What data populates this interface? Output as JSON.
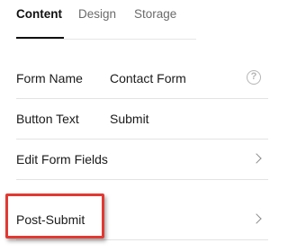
{
  "tabs": [
    {
      "label": "Content",
      "active": true
    },
    {
      "label": "Design",
      "active": false
    },
    {
      "label": "Storage",
      "active": false
    }
  ],
  "rows": {
    "form_name": {
      "label": "Form Name",
      "value": "Contact Form",
      "icon": "help-icon"
    },
    "button_text": {
      "label": "Button Text",
      "value": "Submit"
    },
    "edit_form_fields": {
      "label": "Edit Form Fields",
      "icon": "chevron-right-icon"
    },
    "post_submit": {
      "label": "Post-Submit",
      "icon": "chevron-right-icon"
    }
  },
  "highlight": {
    "color": "#e03a33",
    "target": "post_submit"
  },
  "help_glyph": "?"
}
